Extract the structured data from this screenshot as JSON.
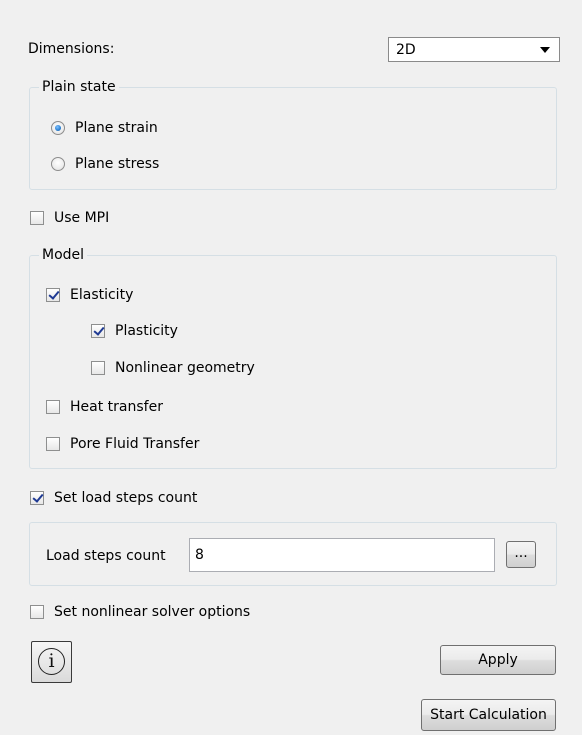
{
  "dimensions": {
    "label": "Dimensions:",
    "selected": "2D"
  },
  "plain_state": {
    "title": "Plain state",
    "options": [
      "Plane strain",
      "Plane stress"
    ],
    "selected_index": 0
  },
  "use_mpi": {
    "label": "Use MPI",
    "checked": false
  },
  "model": {
    "title": "Model",
    "elasticity": {
      "label": "Elasticity",
      "checked": true
    },
    "plasticity": {
      "label": "Plasticity",
      "checked": true
    },
    "nonlinear_geometry": {
      "label": "Nonlinear geometry",
      "checked": false
    },
    "heat_transfer": {
      "label": "Heat transfer",
      "checked": false
    },
    "pore_fluid": {
      "label": "Pore Fluid Transfer",
      "checked": false
    }
  },
  "load_steps": {
    "toggle_label": "Set load steps count",
    "checked": true,
    "field_label": "Load steps count",
    "value": "8",
    "browse_label": "..."
  },
  "nonlinear_solver": {
    "label": "Set nonlinear solver options",
    "checked": false
  },
  "buttons": {
    "info_glyph": "i",
    "apply": "Apply",
    "start": "Start Calculation"
  }
}
